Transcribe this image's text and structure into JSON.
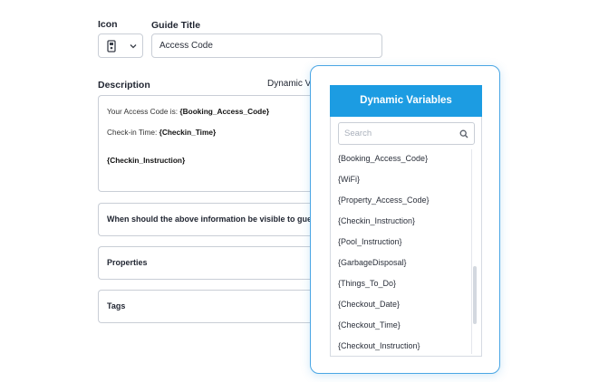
{
  "form": {
    "icon_label": "Icon",
    "guide_title_label": "Guide Title",
    "guide_title_value": "Access Code",
    "description_label": "Description",
    "dynamic_variables_link": "Dynamic Variables",
    "description": {
      "line1_prefix": "Your Access Code is:",
      "line1_var": "{Booking_Access_Code}",
      "line2_prefix": "Check-in Time:",
      "line2_var": "{Checkin_Time}",
      "line3_var": "{Checkin_Instruction}"
    },
    "visibility_question": "When should the above information be visible to guests?",
    "properties_label": "Properties",
    "tags_label": "Tags"
  },
  "dynamic_panel": {
    "title": "Dynamic Variables",
    "search_placeholder": "Search",
    "variables": [
      "{Booking_Access_Code}",
      "{WiFi}",
      "{Property_Access_Code}",
      "{Checkin_Instruction}",
      "{Pool_Instruction}",
      "{GarbageDisposal}",
      "{Things_To_Do}",
      "{Checkout_Date}",
      "{Checkout_Time}",
      "{Checkout_Instruction}"
    ]
  },
  "icons": {
    "selected_icon": "lock-icon",
    "dropdown": "chevron-down-icon",
    "search": "search-icon"
  },
  "colors": {
    "accent": "#1c9ce2",
    "panel_border": "#4aa6e4",
    "field_border": "#c9ced6"
  }
}
